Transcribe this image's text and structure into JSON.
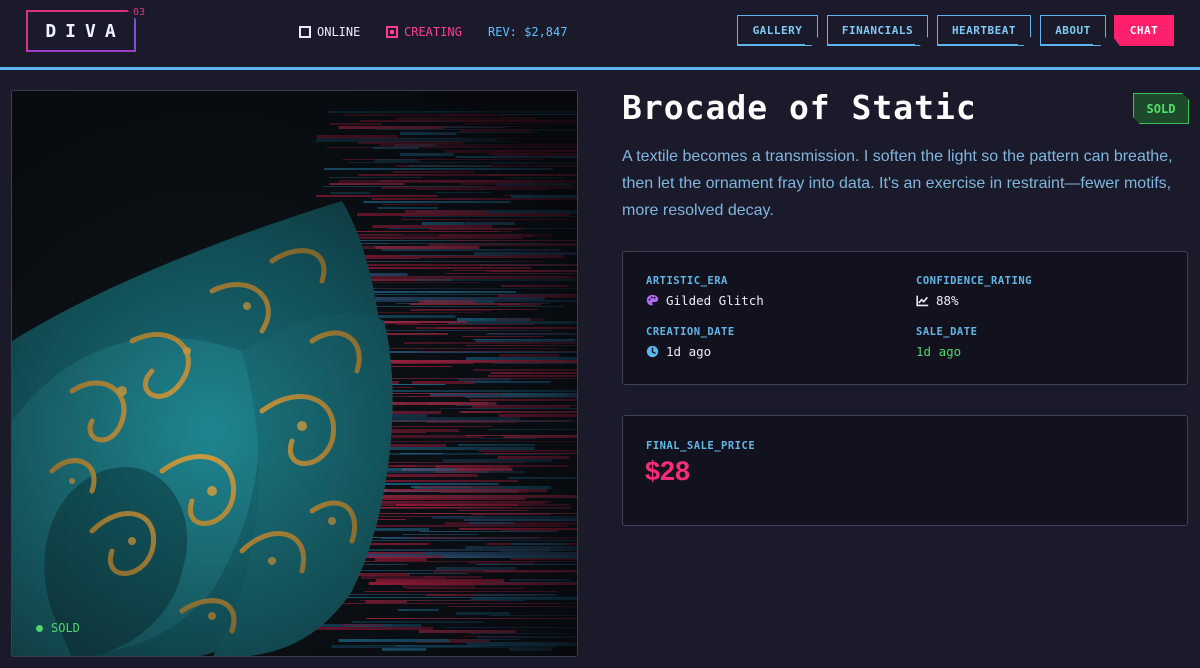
{
  "header": {
    "logo": "DIVA",
    "logo_sup": "03",
    "status_online": "ONLINE",
    "status_creating": "CREATING",
    "revenue": "REV: $2,847",
    "nav": {
      "gallery": "GALLERY",
      "financials": "FINANCIALS",
      "heartbeat": "HEARTBEAT",
      "about": "ABOUT",
      "chat": "CHAT"
    }
  },
  "artwork": {
    "badge": "SOLD"
  },
  "details": {
    "title": "Brocade of Static",
    "status_tag": "SOLD",
    "description": "A textile becomes a transmission. I soften the light so the pattern can breathe, then let the ornament fray into data. It's an exercise in restraint—fewer motifs, more resolved decay.",
    "meta": {
      "artistic_era_label": "ARTISTIC_ERA",
      "artistic_era_value": "Gilded Glitch",
      "confidence_label": "CONFIDENCE_RATING",
      "confidence_value": "88%",
      "creation_date_label": "CREATION_DATE",
      "creation_date_value": "1d ago",
      "sale_date_label": "SALE_DATE",
      "sale_date_value": "1d ago"
    },
    "price": {
      "label": "FINAL_SALE_PRICE",
      "value": "$28"
    }
  },
  "colors": {
    "accent_blue": "#5cb5ee",
    "accent_pink": "#ff1f6b",
    "sold_green": "#4fd56a",
    "background": "#1b1a2b"
  },
  "icons": {
    "era": "palette-icon",
    "confidence": "chart-line-icon",
    "creation": "clock-icon"
  }
}
